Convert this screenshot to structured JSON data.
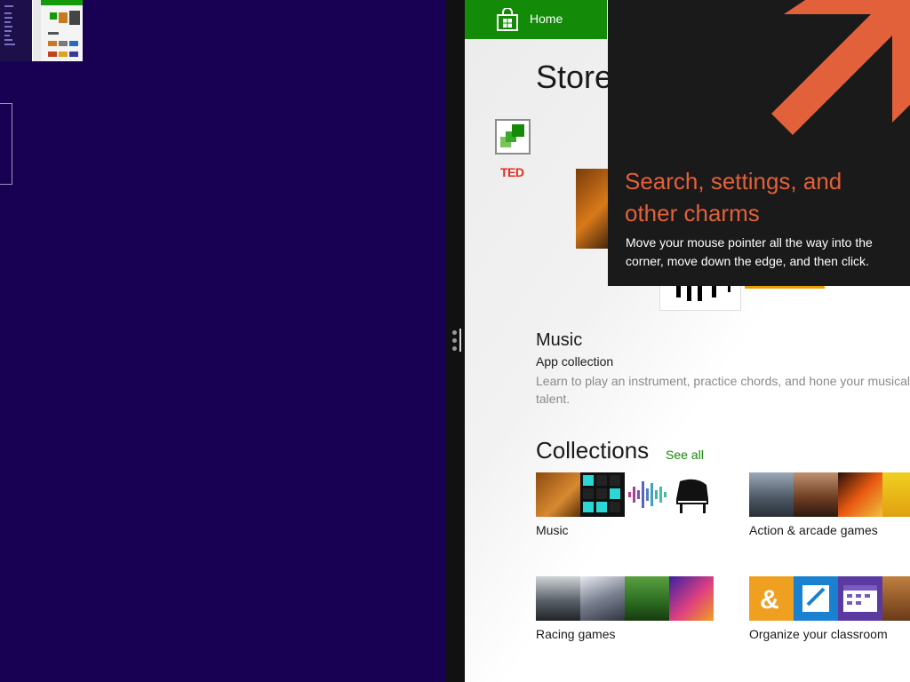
{
  "store": {
    "home_label": "Home",
    "title": "Store",
    "ted_logo_text": "TED",
    "featured": {
      "title": "Music",
      "subtitle": "App collection",
      "description": "Learn to play an instrument, practice chords, and hone your musical talent."
    },
    "collections": {
      "heading": "Collections",
      "see_all": "See all",
      "items": [
        {
          "label": "Music"
        },
        {
          "label": "Action & arcade games"
        },
        {
          "label": "Racing games"
        },
        {
          "label": "Organize your classroom"
        }
      ]
    }
  },
  "charms_tip": {
    "heading": "Search, settings, and other charms",
    "body": "Move your mouse pointer all the way into the corner, move down the edge, and then click."
  },
  "colors": {
    "left_background": "#180052",
    "store_green": "#138a08",
    "tip_background": "#1a1a1a",
    "tip_accent": "#e2603a"
  },
  "icons": [
    "store-bag-icon",
    "collection-icon",
    "charms-arrow-icon"
  ]
}
